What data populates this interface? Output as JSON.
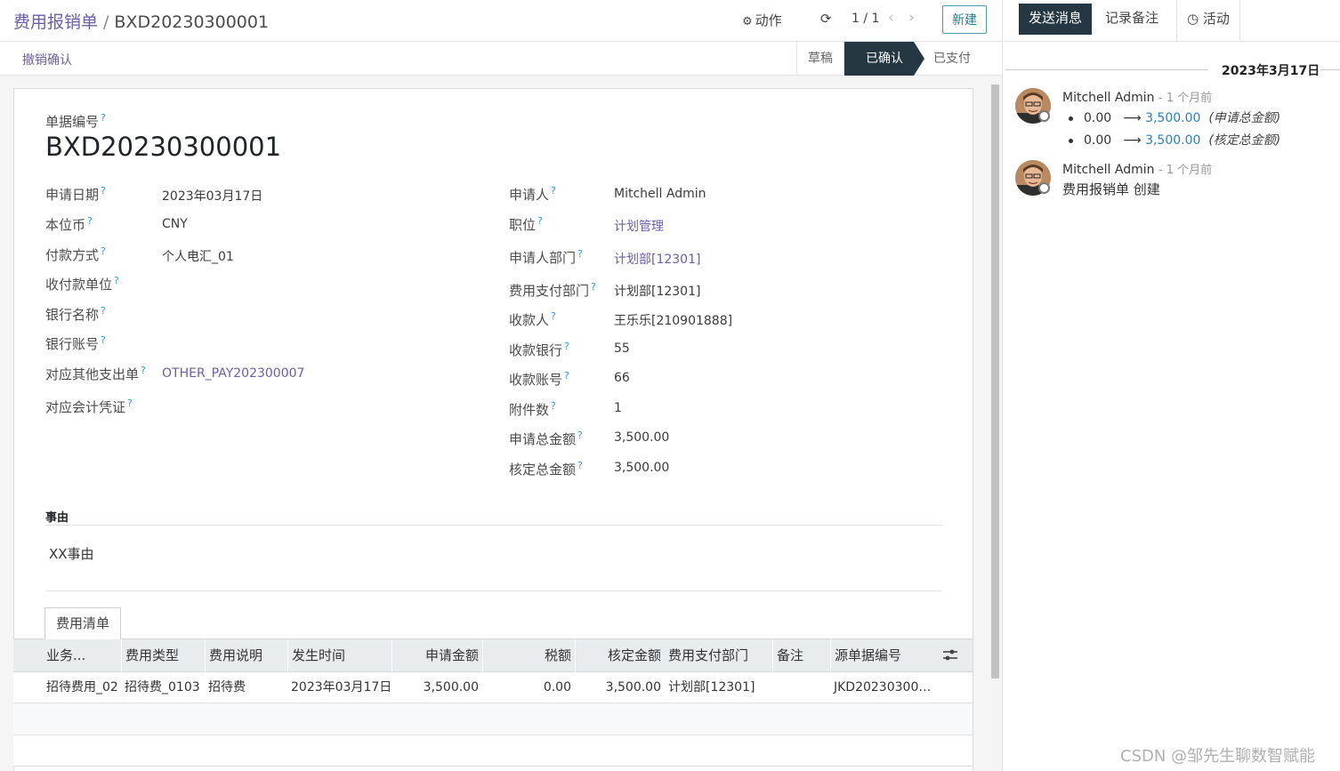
{
  "breadcrumb": {
    "parent": "费用报销单",
    "separator": "/",
    "current": "BXD20230300001"
  },
  "toolbar": {
    "action_label": "动作",
    "pager": "1 / 1",
    "new_label": "新建"
  },
  "statusbar": {
    "undo_label": "撤销确认",
    "stages": [
      "草稿",
      "已确认",
      "已支付"
    ],
    "active_stage": "已确认"
  },
  "form": {
    "title_label": "单据编号",
    "title_value": "BXD20230300001",
    "left_fields": [
      {
        "label": "申请日期",
        "value": "2023年03月17日",
        "link": false
      },
      {
        "label": "本位币",
        "value": "CNY",
        "link": false
      },
      {
        "label": "付款方式",
        "value": "个人电汇_01",
        "link": false
      },
      {
        "label": "收付款单位",
        "value": "",
        "link": false
      },
      {
        "label": "银行名称",
        "value": "",
        "link": false
      },
      {
        "label": "银行账号",
        "value": "",
        "link": false
      },
      {
        "label": "对应其他支出单",
        "value": "OTHER_PAY202300007",
        "link": true
      },
      {
        "label": "对应会计凭证",
        "value": "",
        "link": false
      }
    ],
    "right_fields": [
      {
        "label": "申请人",
        "value": "Mitchell Admin",
        "link": false
      },
      {
        "label": "职位",
        "value": "计划管理",
        "link": true
      },
      {
        "label": "申请人部门",
        "value": "计划部[12301]",
        "link": true
      },
      {
        "label": "费用支付部门",
        "value": "计划部[12301]",
        "link": false
      },
      {
        "label": "收款人",
        "value": "王乐乐[210901888]",
        "link": false
      },
      {
        "label": "收款银行",
        "value": "55",
        "link": false
      },
      {
        "label": "收款账号",
        "value": "66",
        "link": false
      },
      {
        "label": "附件数",
        "value": "1",
        "link": false
      },
      {
        "label": "申请总金额",
        "value": "3,500.00",
        "link": false
      },
      {
        "label": "核定总金额",
        "value": "3,500.00",
        "link": false
      }
    ],
    "reason_label": "事由",
    "reason_value": "XX事由",
    "tab_label": "费用清单",
    "table": {
      "headers": [
        "业务...",
        "费用类型",
        "费用说明",
        "发生时间",
        "申请金额",
        "税额",
        "核定金额",
        "费用支付部门",
        "备注",
        "源单据编号"
      ],
      "rows": [
        [
          "招待费用_02",
          "招待费_0103",
          "招待费",
          "2023年03月17日",
          "3,500.00",
          "0.00",
          "3,500.00",
          "计划部[12301]",
          "",
          "JKD20230300…"
        ]
      ]
    }
  },
  "chatter": {
    "send_message_label": "发送消息",
    "log_note_label": "记录备注",
    "activity_label": "活动",
    "date_separator": "2023年3月17日",
    "messages": [
      {
        "author": "Mitchell Admin",
        "ago": "- 1 个月前",
        "tracking": [
          {
            "old": "0.00",
            "arrow": "⟶",
            "new": "3,500.00",
            "field": "(申请总金额)"
          },
          {
            "old": "0.00",
            "arrow": "⟶",
            "new": "3,500.00",
            "field": "(核定总金额)"
          }
        ]
      },
      {
        "author": "Mitchell Admin",
        "ago": "- 1 个月前",
        "body": "费用报销单 创建"
      }
    ]
  },
  "watermark": "CSDN @邹先生聊数智赋能",
  "colors": {
    "link": "#6f5da6",
    "active_stage": "#243742",
    "new_button_border": "#4d9ba8",
    "tracking_value": "#2a7fb8"
  }
}
